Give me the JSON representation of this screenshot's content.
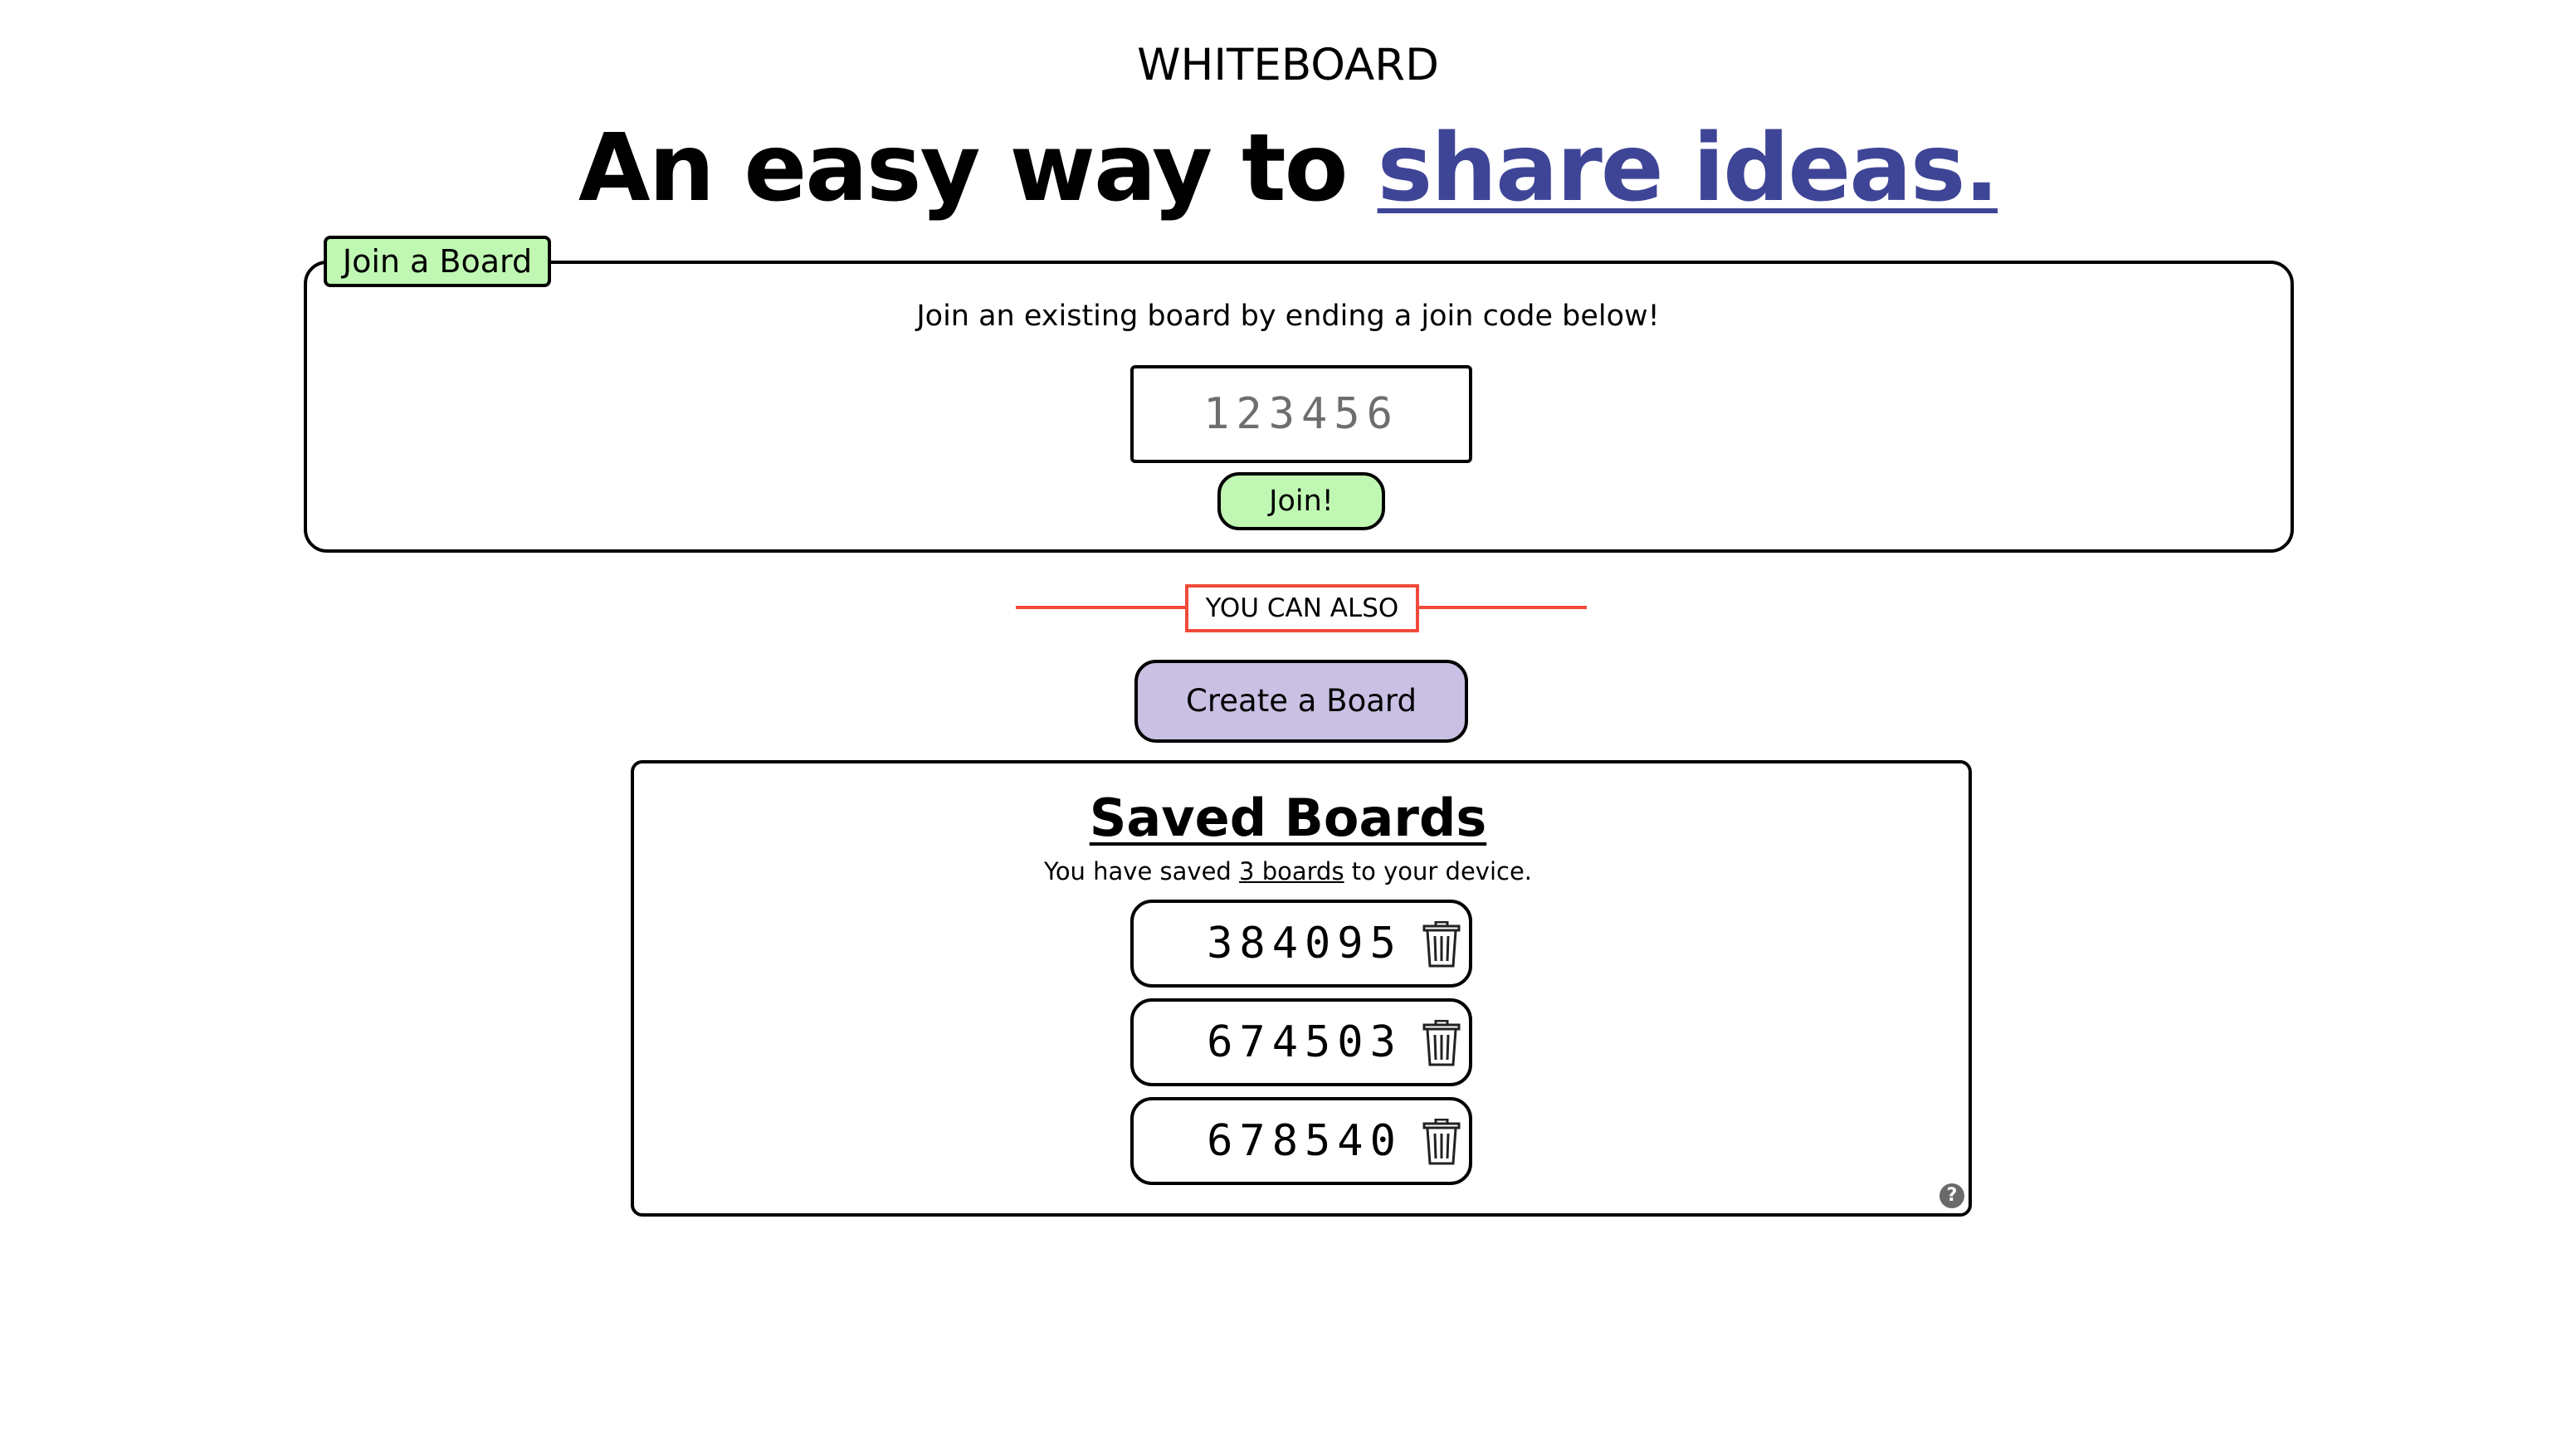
{
  "header": {
    "app_title": "WHITEBOARD",
    "headline_prefix": "An easy way to ",
    "headline_accent": "share ideas."
  },
  "join": {
    "tab_label": "Join a Board",
    "description": "Join an existing board by ending a join code below!",
    "input_placeholder": "123456",
    "input_value": "",
    "button_label": "Join!"
  },
  "divider": {
    "label": "YOU CAN ALSO"
  },
  "create": {
    "button_label": "Create a Board"
  },
  "saved": {
    "title": "Saved Boards",
    "desc_prefix": "You have saved ",
    "desc_count": "3 boards",
    "desc_suffix": " to your device.",
    "boards": [
      {
        "code": "384095",
        "icon": "trash-icon"
      },
      {
        "code": "674503",
        "icon": "trash-icon"
      },
      {
        "code": "678540",
        "icon": "trash-icon"
      }
    ],
    "help_icon": "?"
  },
  "colors": {
    "green": "#c0f8b3",
    "purple": "#c9c0e4",
    "accent_blue": "#3f4596",
    "divider_red": "#f04a3a"
  }
}
